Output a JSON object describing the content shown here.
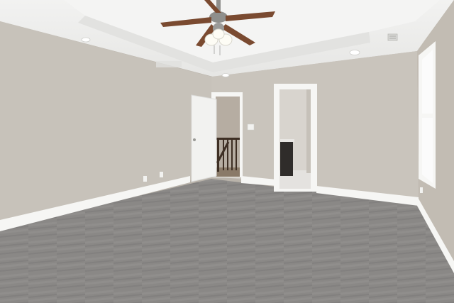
{
  "colors": {
    "ceiling": "#efefee",
    "ceiling_shade": "#e2e2e0",
    "wall_left": "#c7c2ba",
    "wall_back": "#c9c4bc",
    "wall_right": "#c2bcb3",
    "trim": "#f6f6f4",
    "carpet": "#8a8886",
    "carpet_dark": "#787675",
    "door": "#f2f2f0",
    "doorway_dark": "#8a7a68",
    "railing": "#3e2f24",
    "vanity": "#2f2c2a",
    "fan_blade": "#7a4a30",
    "fan_body": "#8f8f8c",
    "window_glass": "#fbfbfb"
  },
  "icons": {
    "fan": "ceiling-fan-icon",
    "vent": "air-vent-icon",
    "light": "recessed-light-icon",
    "outlet": "wall-outlet-icon",
    "switch": "light-switch-icon"
  }
}
